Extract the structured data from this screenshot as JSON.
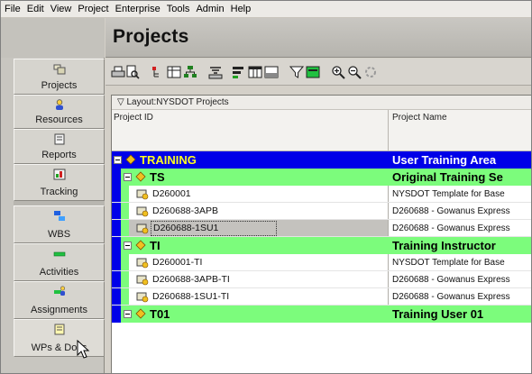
{
  "menu": [
    "File",
    "Edit",
    "View",
    "Project",
    "Enterprise",
    "Tools",
    "Admin",
    "Help"
  ],
  "page_title": "Projects",
  "nav": [
    {
      "label": "Projects",
      "icon": "projects-icon"
    },
    {
      "label": "Resources",
      "icon": "resources-icon"
    },
    {
      "label": "Reports",
      "icon": "reports-icon"
    },
    {
      "label": "Tracking",
      "icon": "tracking-icon"
    },
    {
      "label": "WBS",
      "icon": "wbs-icon"
    },
    {
      "label": "Activities",
      "icon": "activities-icon"
    },
    {
      "label": "Assignments",
      "icon": "assignments-icon"
    },
    {
      "label": "WPs & Docs",
      "icon": "wps-docs-icon"
    }
  ],
  "layout_label": "Layout:NYSDOT Projects",
  "columns": {
    "id": "Project ID",
    "name": "Project Name"
  },
  "rows": [
    {
      "type": "eps0",
      "id": "TRAINING",
      "name": "User Training Area"
    },
    {
      "type": "eps1",
      "id": "TS",
      "name": "Original Training Se"
    },
    {
      "type": "proj",
      "id": "D260001",
      "name": "NYSDOT Template for Base"
    },
    {
      "type": "proj",
      "id": "D260688-3APB",
      "name": "D260688 - Gowanus Express"
    },
    {
      "type": "proj",
      "id": "D260688-1SU1",
      "name": "D260688 - Gowanus Express",
      "selected": true
    },
    {
      "type": "eps1",
      "id": "TI",
      "name": "Training Instructor"
    },
    {
      "type": "proj",
      "id": "D260001-TI",
      "name": "NYSDOT Template for Base"
    },
    {
      "type": "proj",
      "id": "D260688-3APB-TI",
      "name": "D260688 - Gowanus Express"
    },
    {
      "type": "proj",
      "id": "D260688-1SU1-TI",
      "name": "D260688 - Gowanus Express"
    },
    {
      "type": "eps1",
      "id": "T01",
      "name": "Training User 01"
    }
  ],
  "colors": {
    "eps0_bg": "#0000e8",
    "eps0_id": "#ffff20",
    "eps1_bg": "#7cfc7c"
  }
}
